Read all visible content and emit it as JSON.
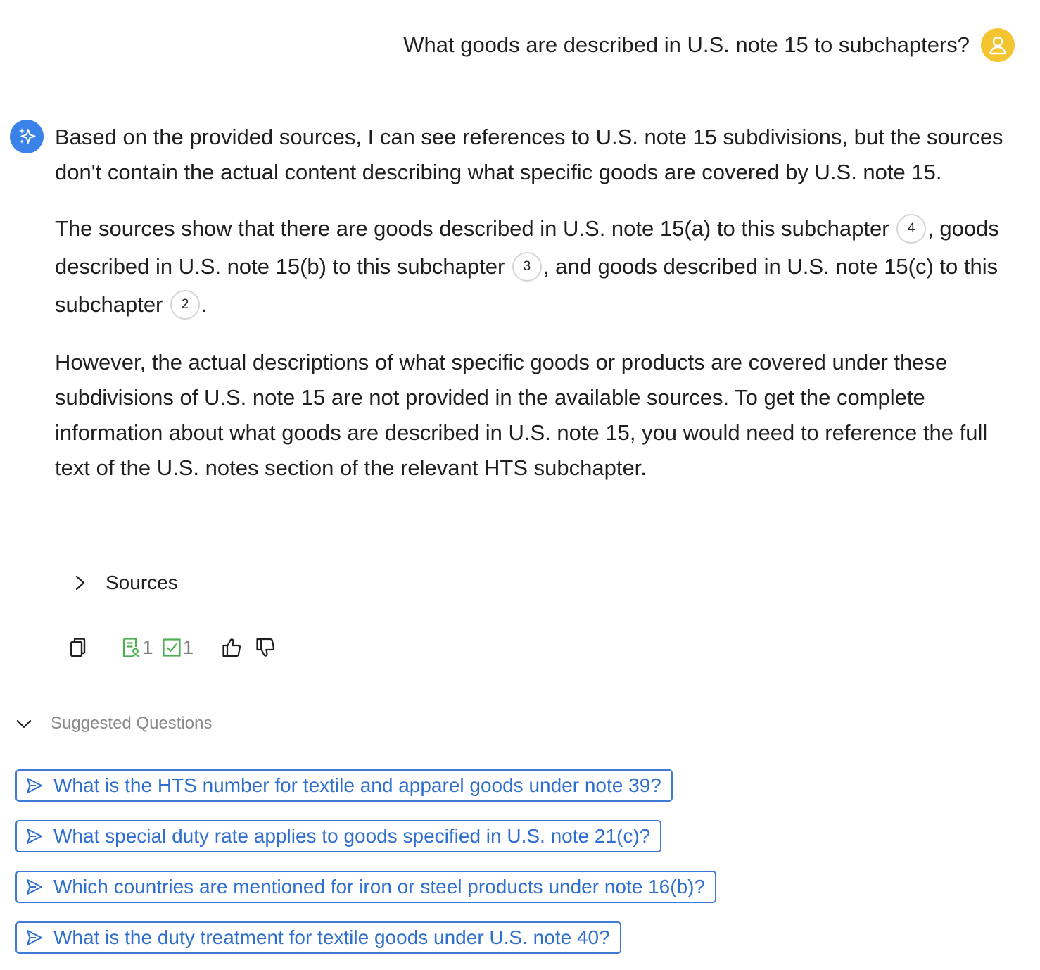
{
  "user_message": {
    "text": "What goods are described in U.S. note 15 to subchapters?",
    "avatar_icon": "user-icon",
    "avatar_color": "#f4c431"
  },
  "assistant": {
    "icon": "sparkle-icon",
    "icon_color": "#3b82e8",
    "paragraph1": "Based on the provided sources, I can see references to U.S. note 15 subdivisions, but the sources don't contain the actual content describing what specific goods are covered by U.S. note 15.",
    "paragraph2": {
      "part1": "The sources show that there are goods described in U.S. note 15(a) to this subchapter",
      "cite1": "4",
      "part2": ", goods described in U.S. note 15(b) to this subchapter",
      "cite2": "3",
      "part3": ", and goods described in U.S. note 15(c) to this subchapter",
      "cite3": "2",
      "part4": "."
    },
    "paragraph3": "However, the actual descriptions of what specific goods or products are covered under these subdivisions of U.S. note 15 are not provided in the available sources. To get the complete information about what goods are described in U.S. note 15, you would need to reference the full text of the U.S. notes section of the relevant HTS subchapter."
  },
  "sources": {
    "label": "Sources",
    "icon": "chevron-right-icon"
  },
  "actions": {
    "copy_icon": "copy-icon",
    "doc_count": "1",
    "check_count": "1",
    "green": "#4caf50",
    "like_icon": "thumbs-up-icon",
    "dislike_icon": "thumbs-down-icon"
  },
  "suggested": {
    "label": "Suggested Questions",
    "icon": "chevron-down-icon",
    "accent": "#2f6fcf",
    "questions": [
      "What is the HTS number for textile and apparel goods under note 39?",
      "What special duty rate applies to goods specified in U.S. note 21(c)?",
      "Which countries are mentioned for iron or steel products under note 16(b)?",
      "What is the duty treatment for textile goods under U.S. note 40?"
    ]
  }
}
